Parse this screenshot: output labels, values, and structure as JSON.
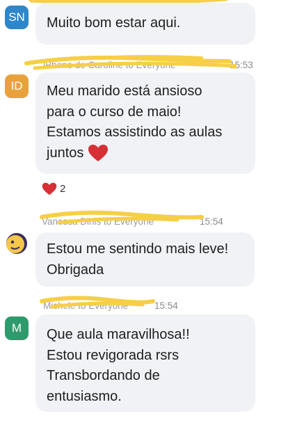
{
  "colors": {
    "bubble": "#f1f2f6",
    "highlight": "#f6cf46",
    "heart": "#d62f35",
    "avatar_sn": "#2f86c8",
    "avatar_id": "#e9a23b",
    "avatar_m": "#2f9a6b"
  },
  "messages": [
    {
      "avatar": "SN",
      "lines": [
        "Muito bom estar aqui."
      ]
    },
    {
      "sender": "iPhone de Caroline to Everyone",
      "time": "15:53",
      "avatar": "ID",
      "lines": [
        "Meu marido está ansioso",
        "para o curso de maio!",
        "Estamos assistindo as aulas",
        "juntos"
      ],
      "trailing_icon": "red-heart-emoji",
      "reaction": {
        "icon": "red-heart-emoji",
        "count": "2"
      }
    },
    {
      "sender": "Vanessa Dinis to Everyone",
      "time": "15:54",
      "avatar_icon": "emoji-face-avatar",
      "lines": [
        "Estou me sentindo mais leve!",
        "Obrigada"
      ]
    },
    {
      "sender": "Michele to Everyone",
      "time": "15:54",
      "avatar": "M",
      "lines": [
        "Que aula maravilhosa!!",
        "Estou revigorada rsrs",
        "Transbordando de",
        "entusiasmo."
      ]
    }
  ]
}
